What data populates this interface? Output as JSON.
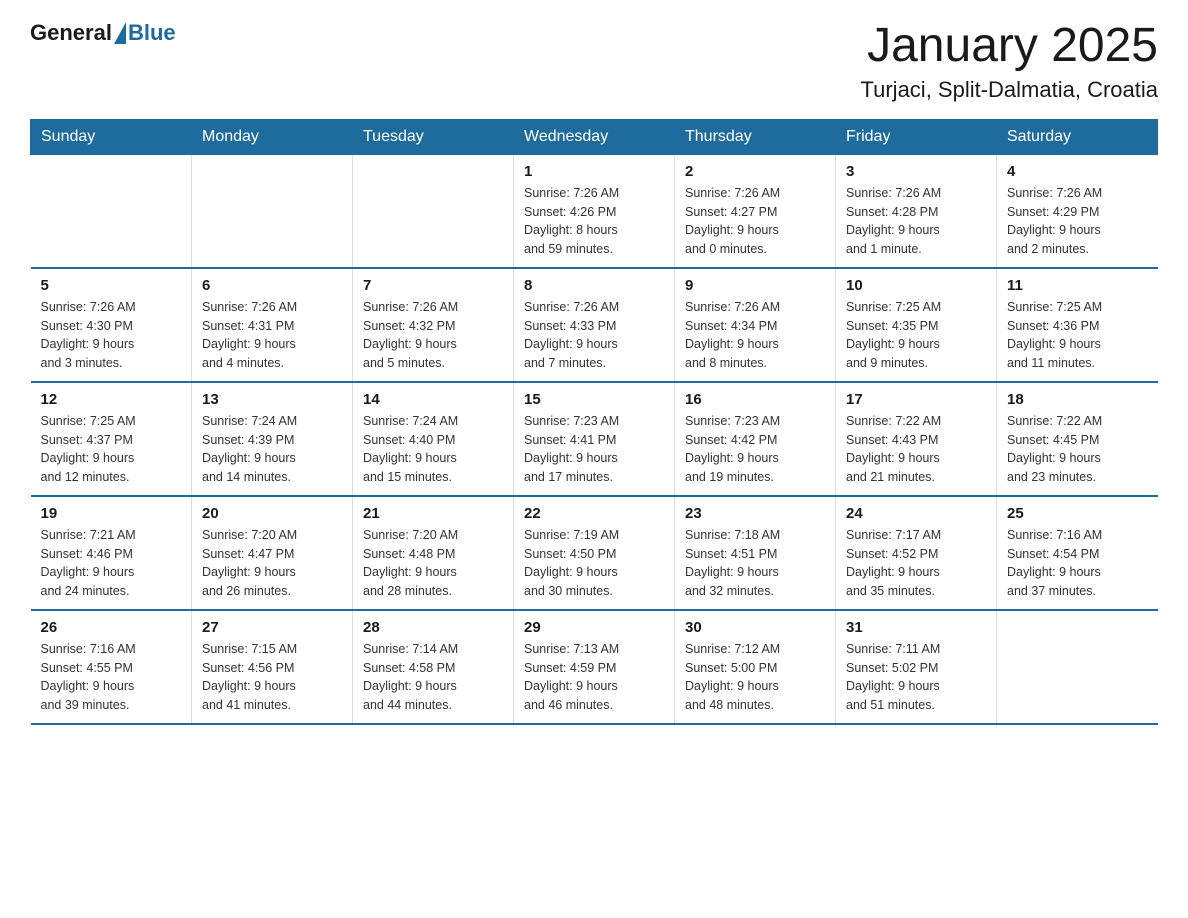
{
  "logo": {
    "general": "General",
    "blue": "Blue"
  },
  "header": {
    "title": "January 2025",
    "subtitle": "Turjaci, Split-Dalmatia, Croatia"
  },
  "weekdays": [
    "Sunday",
    "Monday",
    "Tuesday",
    "Wednesday",
    "Thursday",
    "Friday",
    "Saturday"
  ],
  "weeks": [
    [
      {
        "day": "",
        "info": ""
      },
      {
        "day": "",
        "info": ""
      },
      {
        "day": "",
        "info": ""
      },
      {
        "day": "1",
        "info": "Sunrise: 7:26 AM\nSunset: 4:26 PM\nDaylight: 8 hours\nand 59 minutes."
      },
      {
        "day": "2",
        "info": "Sunrise: 7:26 AM\nSunset: 4:27 PM\nDaylight: 9 hours\nand 0 minutes."
      },
      {
        "day": "3",
        "info": "Sunrise: 7:26 AM\nSunset: 4:28 PM\nDaylight: 9 hours\nand 1 minute."
      },
      {
        "day": "4",
        "info": "Sunrise: 7:26 AM\nSunset: 4:29 PM\nDaylight: 9 hours\nand 2 minutes."
      }
    ],
    [
      {
        "day": "5",
        "info": "Sunrise: 7:26 AM\nSunset: 4:30 PM\nDaylight: 9 hours\nand 3 minutes."
      },
      {
        "day": "6",
        "info": "Sunrise: 7:26 AM\nSunset: 4:31 PM\nDaylight: 9 hours\nand 4 minutes."
      },
      {
        "day": "7",
        "info": "Sunrise: 7:26 AM\nSunset: 4:32 PM\nDaylight: 9 hours\nand 5 minutes."
      },
      {
        "day": "8",
        "info": "Sunrise: 7:26 AM\nSunset: 4:33 PM\nDaylight: 9 hours\nand 7 minutes."
      },
      {
        "day": "9",
        "info": "Sunrise: 7:26 AM\nSunset: 4:34 PM\nDaylight: 9 hours\nand 8 minutes."
      },
      {
        "day": "10",
        "info": "Sunrise: 7:25 AM\nSunset: 4:35 PM\nDaylight: 9 hours\nand 9 minutes."
      },
      {
        "day": "11",
        "info": "Sunrise: 7:25 AM\nSunset: 4:36 PM\nDaylight: 9 hours\nand 11 minutes."
      }
    ],
    [
      {
        "day": "12",
        "info": "Sunrise: 7:25 AM\nSunset: 4:37 PM\nDaylight: 9 hours\nand 12 minutes."
      },
      {
        "day": "13",
        "info": "Sunrise: 7:24 AM\nSunset: 4:39 PM\nDaylight: 9 hours\nand 14 minutes."
      },
      {
        "day": "14",
        "info": "Sunrise: 7:24 AM\nSunset: 4:40 PM\nDaylight: 9 hours\nand 15 minutes."
      },
      {
        "day": "15",
        "info": "Sunrise: 7:23 AM\nSunset: 4:41 PM\nDaylight: 9 hours\nand 17 minutes."
      },
      {
        "day": "16",
        "info": "Sunrise: 7:23 AM\nSunset: 4:42 PM\nDaylight: 9 hours\nand 19 minutes."
      },
      {
        "day": "17",
        "info": "Sunrise: 7:22 AM\nSunset: 4:43 PM\nDaylight: 9 hours\nand 21 minutes."
      },
      {
        "day": "18",
        "info": "Sunrise: 7:22 AM\nSunset: 4:45 PM\nDaylight: 9 hours\nand 23 minutes."
      }
    ],
    [
      {
        "day": "19",
        "info": "Sunrise: 7:21 AM\nSunset: 4:46 PM\nDaylight: 9 hours\nand 24 minutes."
      },
      {
        "day": "20",
        "info": "Sunrise: 7:20 AM\nSunset: 4:47 PM\nDaylight: 9 hours\nand 26 minutes."
      },
      {
        "day": "21",
        "info": "Sunrise: 7:20 AM\nSunset: 4:48 PM\nDaylight: 9 hours\nand 28 minutes."
      },
      {
        "day": "22",
        "info": "Sunrise: 7:19 AM\nSunset: 4:50 PM\nDaylight: 9 hours\nand 30 minutes."
      },
      {
        "day": "23",
        "info": "Sunrise: 7:18 AM\nSunset: 4:51 PM\nDaylight: 9 hours\nand 32 minutes."
      },
      {
        "day": "24",
        "info": "Sunrise: 7:17 AM\nSunset: 4:52 PM\nDaylight: 9 hours\nand 35 minutes."
      },
      {
        "day": "25",
        "info": "Sunrise: 7:16 AM\nSunset: 4:54 PM\nDaylight: 9 hours\nand 37 minutes."
      }
    ],
    [
      {
        "day": "26",
        "info": "Sunrise: 7:16 AM\nSunset: 4:55 PM\nDaylight: 9 hours\nand 39 minutes."
      },
      {
        "day": "27",
        "info": "Sunrise: 7:15 AM\nSunset: 4:56 PM\nDaylight: 9 hours\nand 41 minutes."
      },
      {
        "day": "28",
        "info": "Sunrise: 7:14 AM\nSunset: 4:58 PM\nDaylight: 9 hours\nand 44 minutes."
      },
      {
        "day": "29",
        "info": "Sunrise: 7:13 AM\nSunset: 4:59 PM\nDaylight: 9 hours\nand 46 minutes."
      },
      {
        "day": "30",
        "info": "Sunrise: 7:12 AM\nSunset: 5:00 PM\nDaylight: 9 hours\nand 48 minutes."
      },
      {
        "day": "31",
        "info": "Sunrise: 7:11 AM\nSunset: 5:02 PM\nDaylight: 9 hours\nand 51 minutes."
      },
      {
        "day": "",
        "info": ""
      }
    ]
  ]
}
